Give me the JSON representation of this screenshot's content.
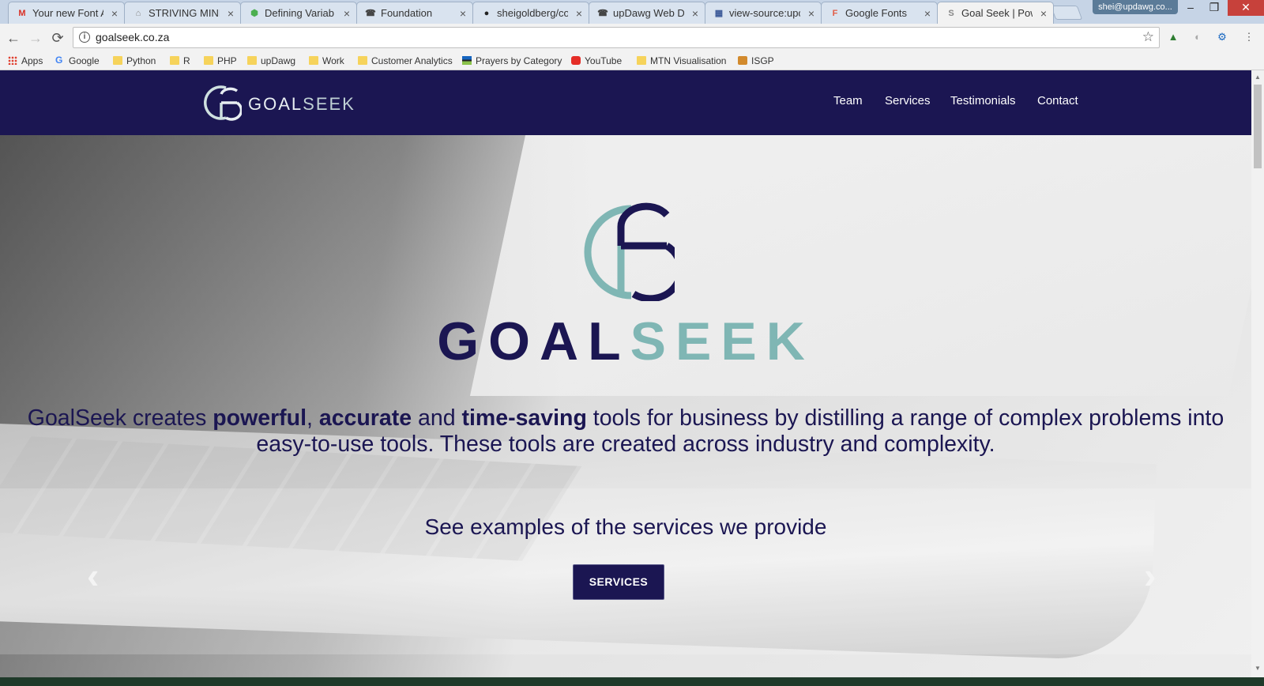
{
  "browser": {
    "tabs": [
      {
        "label": "Your new Font A",
        "favicon": "M",
        "favicon_color": "#d93025"
      },
      {
        "label": "STRIVING MIND",
        "favicon": "⌂",
        "favicon_color": "#888888"
      },
      {
        "label": "Defining Variab",
        "favicon": "⬢",
        "favicon_color": "#4caf50"
      },
      {
        "label": "Foundation",
        "favicon": "☎",
        "favicon_color": "#444444"
      },
      {
        "label": "sheigoldberg/co",
        "favicon": "●",
        "favicon_color": "#222222"
      },
      {
        "label": "upDawg Web D",
        "favicon": "☎",
        "favicon_color": "#444444"
      },
      {
        "label": "view-source:upc",
        "favicon": "▦",
        "favicon_color": "#3b5998"
      },
      {
        "label": "Google Fonts",
        "favicon": "F",
        "favicon_color": "#e25b45"
      },
      {
        "label": "Goal Seek | Pow",
        "favicon": "S",
        "favicon_color": "#888888"
      }
    ],
    "close_glyph": "×",
    "profile": "shei@updawg.co...",
    "window_controls": {
      "minimize": "–",
      "restore": "❐",
      "close": "✕"
    },
    "nav": {
      "back": "←",
      "forward": "→",
      "reload": "⟳"
    },
    "address": {
      "info": "i",
      "url": "goalseek.co.za",
      "star": "☆"
    },
    "extensions": [
      "▲",
      "◐",
      "⚙",
      "⋮"
    ],
    "bookmarks": [
      {
        "label": "Apps",
        "icon": "apps-grid-icon"
      },
      {
        "label": "Google",
        "icon": "google-icon"
      },
      {
        "label": "Python",
        "icon": "folder-icon"
      },
      {
        "label": "R",
        "icon": "folder-icon"
      },
      {
        "label": "PHP",
        "icon": "folder-icon"
      },
      {
        "label": "upDawg",
        "icon": "folder-icon"
      },
      {
        "label": "Work",
        "icon": "folder-icon"
      },
      {
        "label": "Customer Analytics",
        "icon": "folder-icon"
      },
      {
        "label": "Prayers by Category",
        "icon": "flag-icon"
      },
      {
        "label": "YouTube",
        "icon": "youtube-icon"
      },
      {
        "label": "MTN Visualisation",
        "icon": "folder-icon"
      },
      {
        "label": "ISGP",
        "icon": "isgp-icon"
      }
    ]
  },
  "site": {
    "brand": {
      "part1": "GOAL",
      "part2": "SEEK"
    },
    "menu": [
      "Team",
      "Services",
      "Testimonials",
      "Contact"
    ],
    "hero": {
      "word_dark": "GOAL",
      "word_light": "SEEK",
      "tagline": {
        "t1": "GoalSeek creates ",
        "b1": "powerful",
        "t2": ", ",
        "b2": "accurate",
        "t3": " and ",
        "b3": "time-saving",
        "t4": " tools for business by distilling a range of complex problems into easy-to-use tools. These tools are created across industry and complexity."
      },
      "see_examples": "See examples of the services we provide",
      "services_button": "SERVICES",
      "prev_arrow": "‹",
      "next_arrow": "›"
    },
    "colors": {
      "navy": "#1b1652",
      "teal": "#7fb6b4"
    }
  }
}
